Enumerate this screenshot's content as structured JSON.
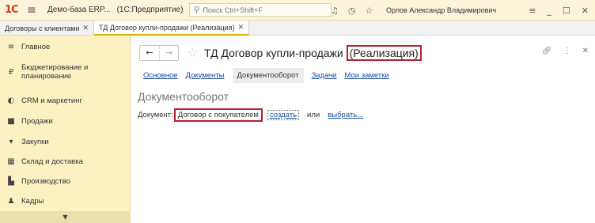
{
  "titlebar": {
    "logo": "1С",
    "app_title": "Демо-база ERP...",
    "app_sub": "(1С:Предприятие)",
    "search_placeholder": "Поиск Ctrl+Shift+F",
    "user": "Орлов Александр Владимирович"
  },
  "tabs": [
    {
      "label": "Договоры с клиентами",
      "active": false
    },
    {
      "label": "ТД Договор купли-продажи (Реализация)",
      "active": true
    }
  ],
  "sidebar": {
    "items": [
      {
        "label": "Главное",
        "icon": "menu-lines-icon"
      },
      {
        "label": "Бюджетирование и планирование",
        "icon": "budget-icon"
      },
      {
        "label": "CRM и маркетинг",
        "icon": "crm-icon"
      },
      {
        "label": "Продажи",
        "icon": "bag-icon"
      },
      {
        "label": "Закупки",
        "icon": "cart-icon"
      },
      {
        "label": "Склад и доставка",
        "icon": "warehouse-icon"
      },
      {
        "label": "Производство",
        "icon": "factory-icon"
      },
      {
        "label": "Кадры",
        "icon": "person-icon"
      }
    ]
  },
  "main": {
    "title_prefix": "ТД Договор купли-продажи",
    "title_highlight": "(Реализация)",
    "subnav": {
      "main": "Основное",
      "documents": "Документы",
      "docflow": "Документооборот",
      "tasks": "Задачи",
      "notes": "Мои заметки"
    },
    "section_title": "Документооборот",
    "doc_row": {
      "label": "Документ:",
      "value": "Договор с покупателем",
      "create": "создать",
      "or": "или",
      "choose": "выбрать..."
    }
  },
  "colors": {
    "sidebar_bg": "#fbf1c3",
    "titlebar_bg": "#fbf4d9",
    "link": "#1b4fa0",
    "highlight_border": "#b8202a"
  }
}
